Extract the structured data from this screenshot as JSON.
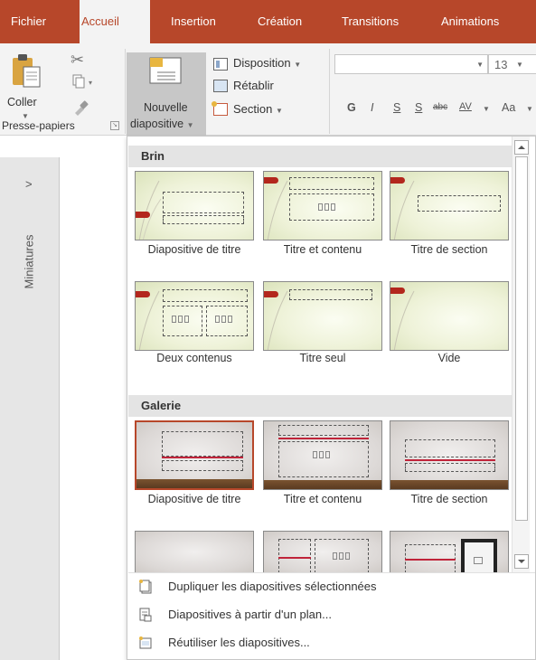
{
  "tabs": [
    {
      "label": "Fichier",
      "active": false
    },
    {
      "label": "Accueil",
      "active": true
    },
    {
      "label": "Insertion",
      "active": false
    },
    {
      "label": "Création",
      "active": false
    },
    {
      "label": "Transitions",
      "active": false
    },
    {
      "label": "Animations",
      "active": false
    }
  ],
  "ribbon": {
    "coller": "Coller",
    "presse_papiers": "Presse-papiers",
    "nouvelle": "Nouvelle",
    "diapositive": "diapositive",
    "disposition": "Disposition",
    "retablir": "Rétablir",
    "section": "Section",
    "font_size": "13",
    "font_buttons": [
      "G",
      "I",
      "S",
      "S",
      "abc",
      "AV",
      "Aa"
    ]
  },
  "left_pane": {
    "expand_glyph": ">",
    "label": "Miniatures"
  },
  "gallery": {
    "sections": [
      {
        "title": "Brin",
        "layouts": [
          "Diapositive de titre",
          "Titre et contenu",
          "Titre de section",
          "Deux contenus",
          "Titre seul",
          "Vide"
        ]
      },
      {
        "title": "Galerie",
        "layouts": [
          "Diapositive de titre",
          "Titre et contenu",
          "Titre de section",
          "",
          "",
          ""
        ]
      }
    ],
    "menu": [
      "Dupliquer les diapositives sélectionnées",
      "Diapositives à partir d'un plan...",
      "Réutiliser les diapositives..."
    ]
  },
  "colors": {
    "accent": "#b7472a",
    "ribbon_bg": "#f3f3f3"
  }
}
